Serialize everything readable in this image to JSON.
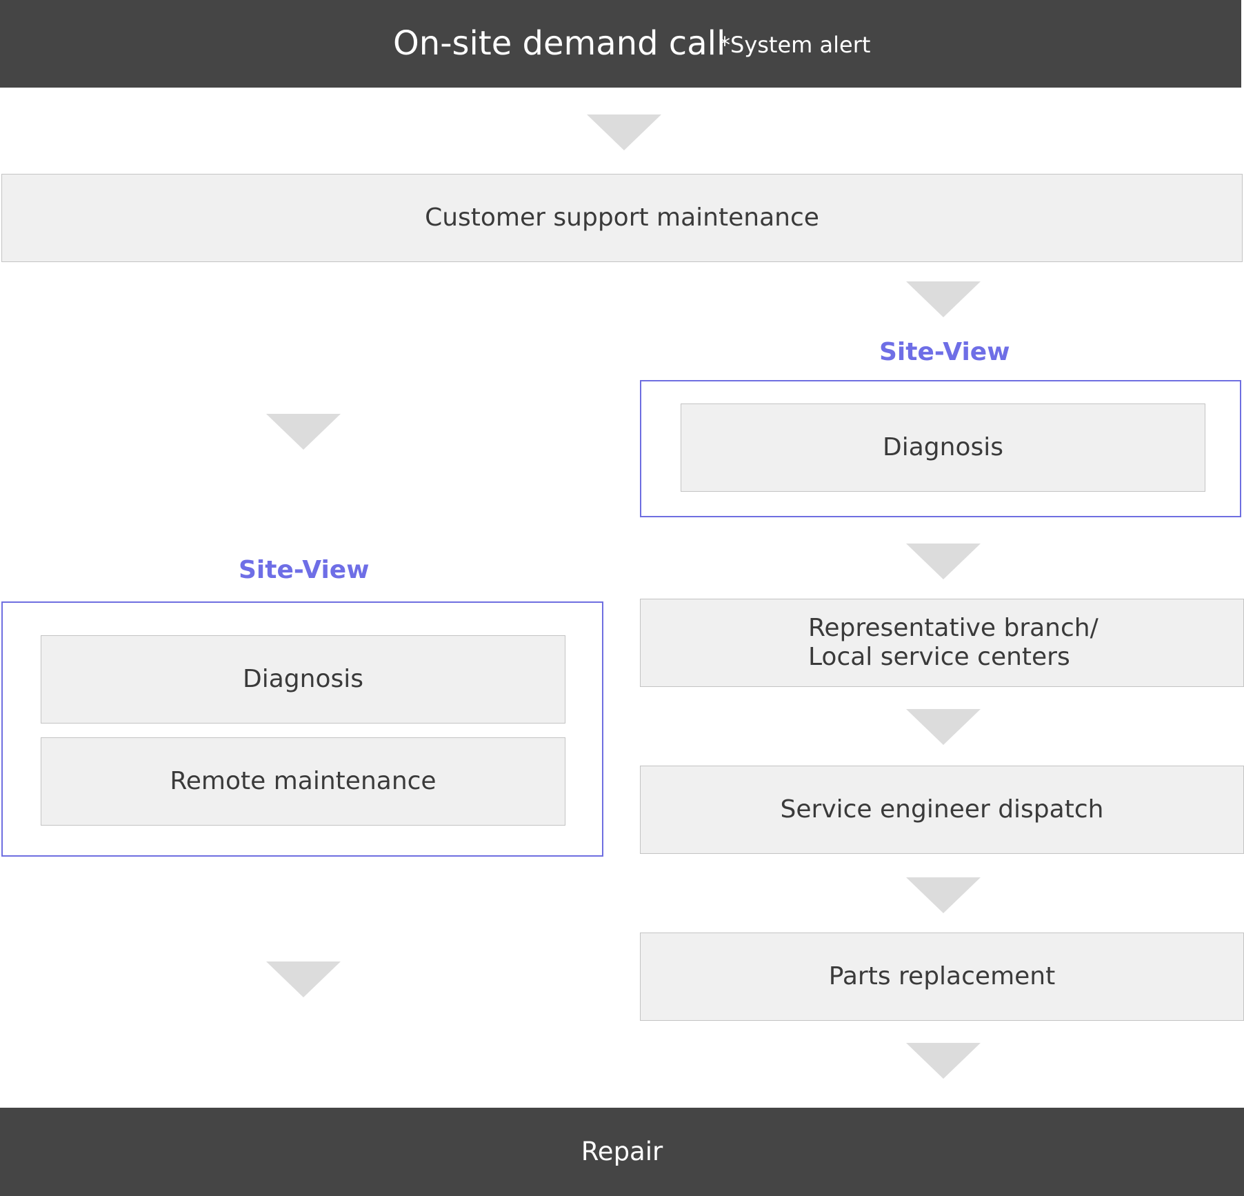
{
  "header": {
    "title": "On-site demand call",
    "note": "*System alert"
  },
  "steps": {
    "customer_support": "Customer support maintenance",
    "representative_line1": "Representative branch/",
    "representative_line2": "Local service centers",
    "service_engineer": "Service engineer dispatch",
    "parts_replacement": "Parts replacement"
  },
  "right_group": {
    "title": "Site-View",
    "diagnosis": "Diagnosis"
  },
  "left_group": {
    "title": "Site-View",
    "diagnosis": "Diagnosis",
    "remote": "Remote maintenance"
  },
  "footer": {
    "label": "Repair"
  },
  "colors": {
    "bar": "#454545",
    "box_fill": "#f0f0f0",
    "accent": "#6e6ee6",
    "arrow": "#dcdcdc"
  }
}
